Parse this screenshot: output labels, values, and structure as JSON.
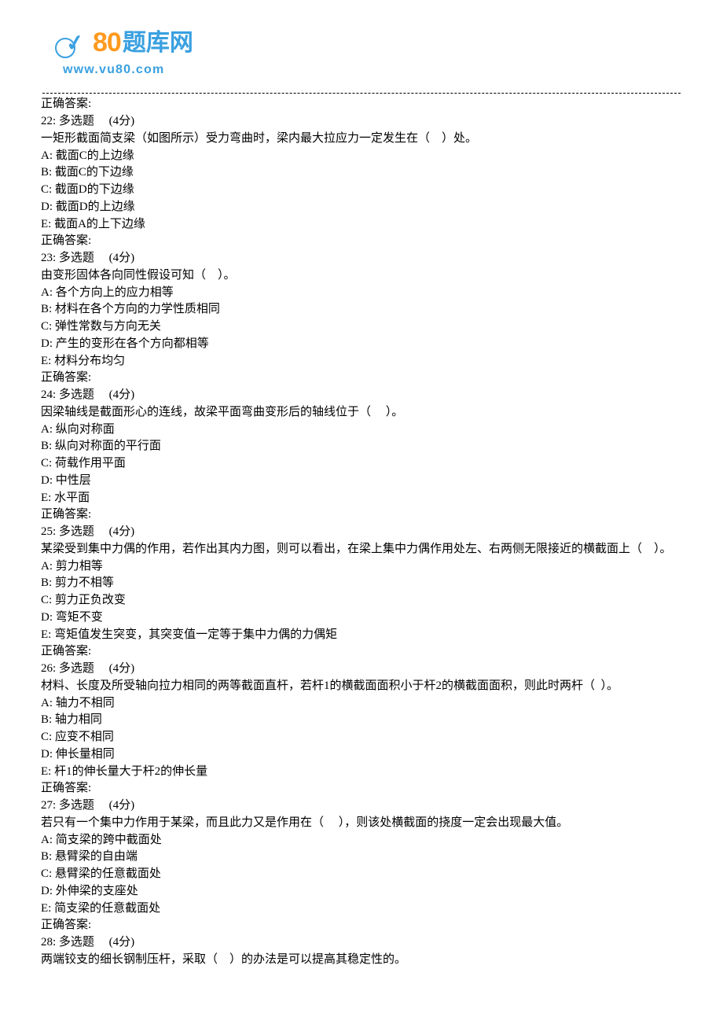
{
  "logo": {
    "number": "80",
    "cn": "题库网",
    "url": "www.vu80.com"
  },
  "lines": [
    "正确答案:",
    "22: 多选题     (4分)",
    "一矩形截面简支梁（如图所示）受力弯曲时，梁内最大拉应力一定发生在（    ）处。",
    "A: 截面C的上边缘",
    "B: 截面C的下边缘",
    "C: 截面D的下边缘",
    "D: 截面D的上边缘",
    "E: 截面A的上下边缘",
    "正确答案:",
    "23: 多选题     (4分)",
    "由变形固体各向同性假设可知（    ）。",
    "A: 各个方向上的应力相等",
    "B: 材料在各个方向的力学性质相同",
    "C: 弹性常数与方向无关",
    "D: 产生的变形在各个方向都相等",
    "E: 材料分布均匀",
    "正确答案:",
    "24: 多选题     (4分)",
    "因梁轴线是截面形心的连线，故梁平面弯曲变形后的轴线位于（     ）。",
    "A: 纵向对称面",
    "B: 纵向对称面的平行面",
    "C: 荷载作用平面",
    "D: 中性层",
    "E: 水平面",
    "正确答案:",
    "25: 多选题     (4分)",
    "某梁受到集中力偶的作用，若作出其内力图，则可以看出，在梁上集中力偶作用处左、右两侧无限接近的横截面上（    ）。",
    "A: 剪力相等",
    "B: 剪力不相等",
    "C: 剪力正负改变",
    "D: 弯矩不变",
    "E: 弯矩值发生突变，其突变值一定等于集中力偶的力偶矩",
    "正确答案:",
    "26: 多选题     (4分)",
    "材料、长度及所受轴向拉力相同的两等截面直杆，若杆1的横截面面积小于杆2的横截面面积，则此时两杆（  ）。",
    "A: 轴力不相同",
    "B: 轴力相同",
    "C: 应变不相同",
    "D: 伸长量相同",
    "E: 杆1的伸长量大于杆2的伸长量",
    "正确答案:",
    "27: 多选题     (4分)",
    "若只有一个集中力作用于某梁，而且此力又是作用在（     ），则该处横截面的挠度一定会出现最大值。",
    "A: 简支梁的跨中截面处",
    "B: 悬臂梁的自由端",
    "C: 悬臂梁的任意截面处",
    "D: 外伸梁的支座处",
    "E: 简支梁的任意截面处",
    "正确答案:",
    "28: 多选题     (4分)",
    "两端铰支的细长钢制压杆，采取（    ）的办法是可以提高其稳定性的。"
  ]
}
